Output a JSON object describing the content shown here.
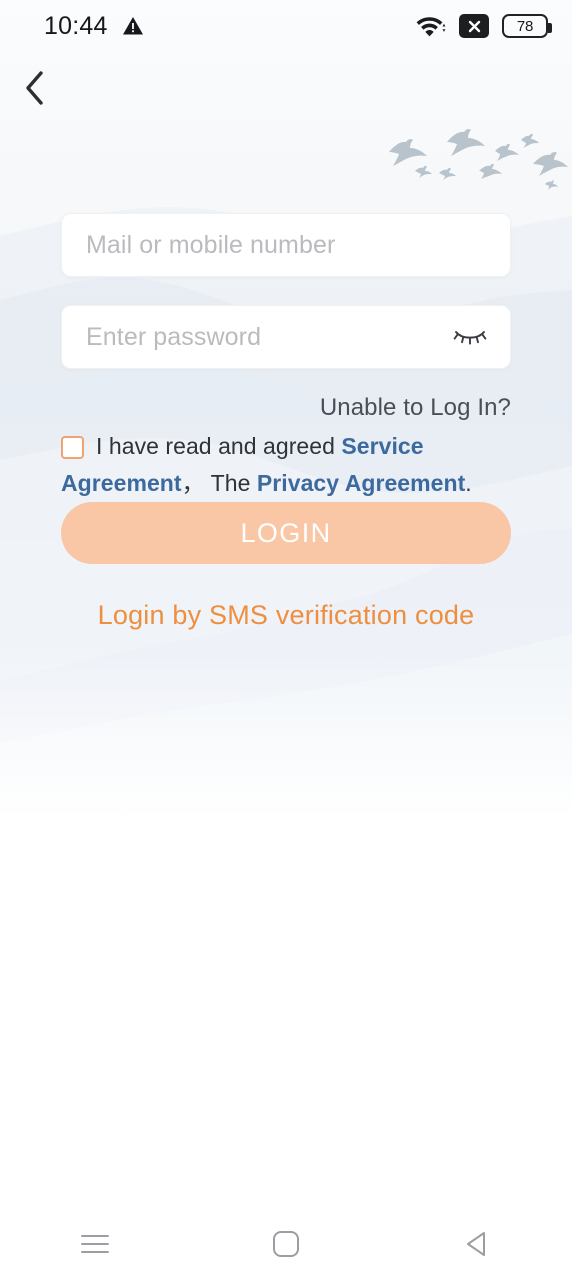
{
  "statusbar": {
    "time": "10:44",
    "warning_icon": "warning-triangle-icon",
    "wifi_icon": "wifi-icon",
    "nosignal_icon": "mobile-data-off-icon",
    "battery_level": "78"
  },
  "navigation": {
    "back_icon": "chevron-left-icon"
  },
  "decor": {
    "birds": "flying-birds-illustration",
    "mountains": "mountain-silhouette-illustration"
  },
  "form": {
    "account": {
      "placeholder": "Mail or mobile number",
      "value": ""
    },
    "password": {
      "placeholder": "Enter password",
      "value": "",
      "toggle_icon": "eye-closed-icon"
    },
    "unable_to_login": "Unable to Log In?",
    "agreement": {
      "prefix": "I have read and agreed ",
      "service_link": "Service Agreement",
      "separator": "， The ",
      "privacy_link": "Privacy Agreement",
      "suffix": ".",
      "checked": false
    },
    "login_label": "LOGIN",
    "sms_login_label": "Login by SMS verification code"
  },
  "systembar": {
    "recents_icon": "menu-icon",
    "home_icon": "home-square-icon",
    "back_icon": "back-triangle-icon"
  },
  "colors": {
    "accent_orange": "#ee8f3f",
    "button_disabled": "#f9c7a5",
    "link_blue": "#3d6a9e",
    "checkbox_border": "#f0a372"
  }
}
